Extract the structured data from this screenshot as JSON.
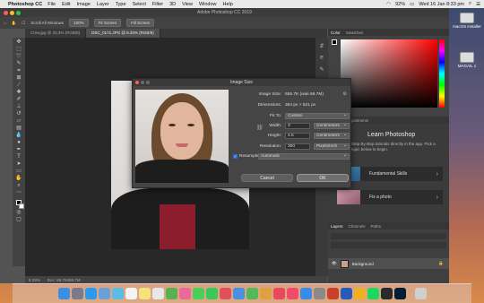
{
  "menubar": {
    "app": "Photoshop CC",
    "items": [
      "File",
      "Edit",
      "Image",
      "Layer",
      "Type",
      "Select",
      "Filter",
      "3D",
      "View",
      "Window",
      "Help"
    ],
    "window_title": "Adobe Photoshop CC 2019",
    "battery": "92%",
    "clock": "Wed 16 Jan 8:33 pm"
  },
  "options_bar": {
    "scroll_all": "Scroll All Windows",
    "zoom": "100%",
    "fit_screen": "Fit Screen",
    "fill_screen": "Fill Screen"
  },
  "doc_tabs": [
    "Crew.jpg @ 33.3% (RGB/8)",
    "DSC_0171.JPG @ 8.33% (RGB/8)"
  ],
  "status_bar": {
    "zoom": "8.33%",
    "doc": "Doc: 65.7M/65.7M"
  },
  "panels": {
    "color_tabs": [
      "Color",
      "Swatches"
    ],
    "learn_tabs": [
      "Learn",
      "Adjustments"
    ],
    "learn_title": "Learn Photoshop",
    "learn_text": "Step-by-step tutorials directly in the app. Pick a topic below to begin.",
    "learn_items": [
      "Fundamental Skills",
      "Fix a photo"
    ],
    "layer_tabs": [
      "Layers",
      "Channels",
      "Paths"
    ],
    "layer_name": "Background"
  },
  "dialog": {
    "title": "Image Size",
    "image_size_label": "Image Size:",
    "image_size_value": "555.7K (was 68.7M)",
    "dimensions_label": "Dimensions:",
    "dimensions_value": "364 px  ×  521 px",
    "fit_to_label": "Fit To:",
    "fit_to_value": "Custom",
    "width_label": "Width:",
    "width_value": "3",
    "width_unit": "Centimeters",
    "height_label": "Height:",
    "height_value": "4.5",
    "height_unit": "Centimeters",
    "resolution_label": "Resolution:",
    "resolution_value": "300",
    "resolution_unit": "Pixels/Inch",
    "resample_label": "Resample:",
    "resample_value": "Automatic",
    "cancel": "Cancel",
    "ok": "OK"
  },
  "desktop": {
    "icons": [
      "macOS installer",
      "MAGAIL 1"
    ]
  }
}
